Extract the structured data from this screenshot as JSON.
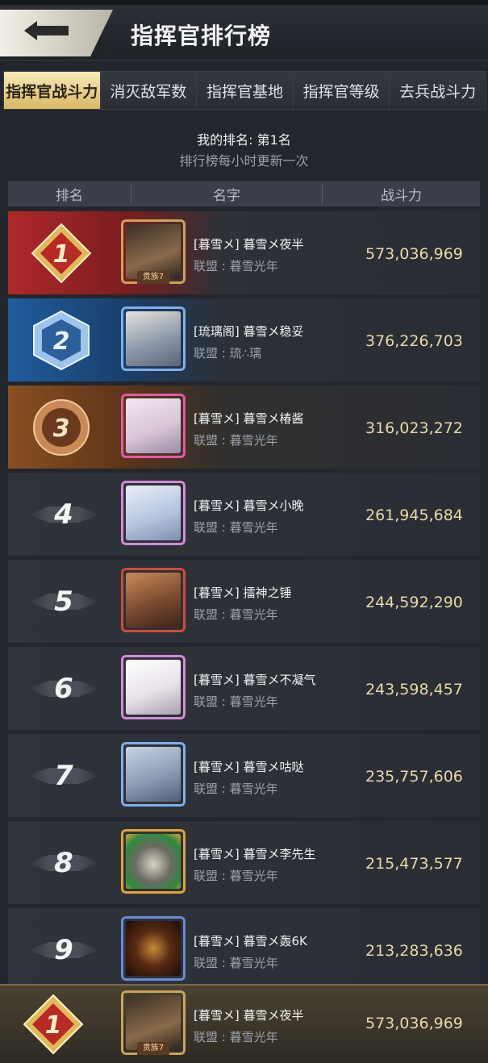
{
  "header": {
    "title": "指挥官排行榜"
  },
  "tabs": [
    {
      "label": "指挥官战斗力",
      "active": true
    },
    {
      "label": "消灭敌军数",
      "active": false
    },
    {
      "label": "指挥官基地",
      "active": false
    },
    {
      "label": "指挥官等级",
      "active": false
    },
    {
      "label": "去兵战斗力",
      "active": false
    }
  ],
  "summary": {
    "my_rank": "我的排名: 第1名",
    "refresh_note": "排行榜每小时更新一次"
  },
  "columns": {
    "rank": "排名",
    "name": "名字",
    "power": "战斗力"
  },
  "rows": [
    {
      "rank": "1",
      "name": "[暮雪メ] 暮雪メ夜半",
      "alliance": "联盟 : 暮雪光年",
      "power": "573,036,969",
      "noble": "贵族7",
      "avatar_color": "#6b4a2e"
    },
    {
      "rank": "2",
      "name": "[琉璃阁] 暮雪メ稳妥",
      "alliance": "联盟 : 琉∴璃",
      "power": "376,226,703",
      "noble": "",
      "avatar_color": "#8e9aab"
    },
    {
      "rank": "3",
      "name": "[暮雪メ] 暮雪メ椿酱",
      "alliance": "联盟 : 暮雪光年",
      "power": "316,023,272",
      "noble": "",
      "avatar_color": "#d9c6d8"
    },
    {
      "rank": "4",
      "name": "[暮雪メ] 暮雪メ小晚",
      "alliance": "联盟 : 暮雪光年",
      "power": "261,945,684",
      "noble": "",
      "avatar_color": "#b7c6e0"
    },
    {
      "rank": "5",
      "name": "[暮雪メ] 擂神之锤",
      "alliance": "联盟 : 暮雪光年",
      "power": "244,592,290",
      "noble": "",
      "avatar_color": "#7a4a30"
    },
    {
      "rank": "6",
      "name": "[暮雪メ] 暮雪メ不凝气",
      "alliance": "联盟 : 暮雪光年",
      "power": "243,598,457",
      "noble": "",
      "avatar_color": "#e8e3ea"
    },
    {
      "rank": "7",
      "name": "[暮雪メ] 暮雪メ咕哒",
      "alliance": "联盟 : 暮雪光年",
      "power": "235,757,606",
      "noble": "",
      "avatar_color": "#8d9cb4"
    },
    {
      "rank": "8",
      "name": "[暮雪メ] 暮雪メ李先生",
      "alliance": "联盟 : 暮雪光年",
      "power": "215,473,577",
      "noble": "",
      "avatar_color": "#6a6a62"
    },
    {
      "rank": "9",
      "name": "[暮雪メ] 暮雪メ轰6K",
      "alliance": "联盟 : 暮雪光年",
      "power": "213,283,636",
      "noble": "",
      "avatar_color": "#3a2418"
    }
  ],
  "my_row": {
    "rank": "1",
    "name": "[暮雪メ] 暮雪メ夜半",
    "alliance": "联盟 : 暮雪光年",
    "power": "573,036,969",
    "noble": "贵族7"
  }
}
